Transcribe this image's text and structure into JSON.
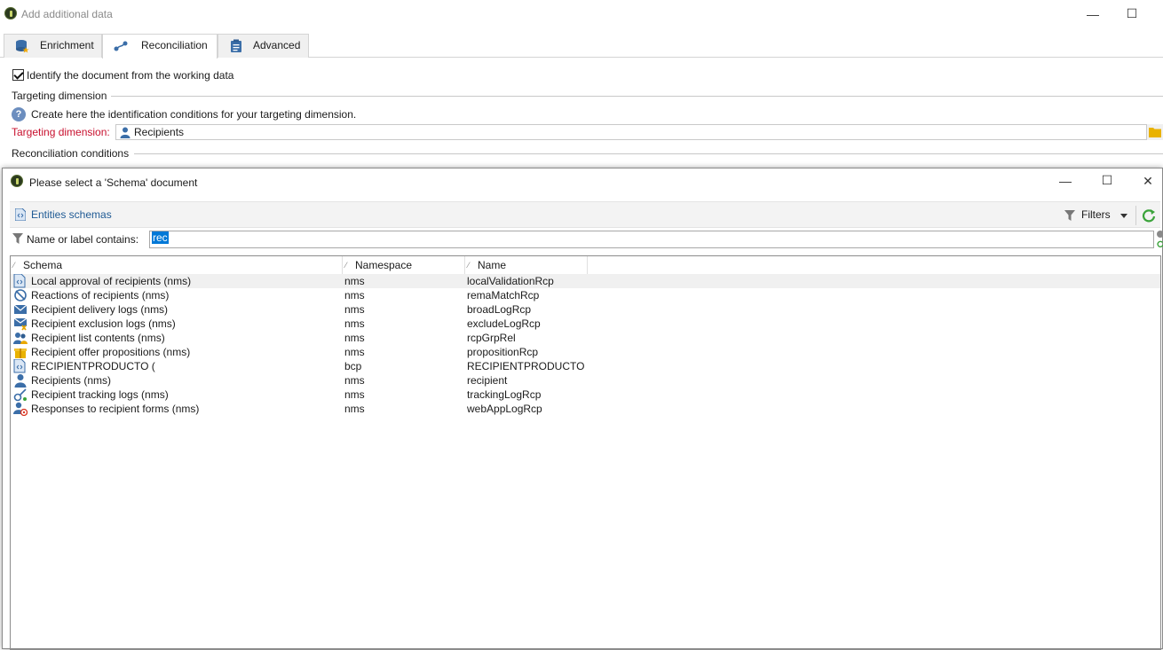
{
  "outer_window": {
    "title": "Add additional data",
    "minimize": "—",
    "maximize": "☐"
  },
  "tabs": [
    {
      "label": "Enrichment",
      "icon": "database-star-icon"
    },
    {
      "label": "Reconciliation",
      "icon": "link-icon"
    },
    {
      "label": "Advanced",
      "icon": "clipboard-icon"
    }
  ],
  "reconciliation": {
    "checkbox_label": "Identify the document from the working data",
    "section_targeting": "Targeting dimension",
    "help_text": "Create here the identification conditions for your targeting dimension.",
    "targeting_label": "Targeting dimension:",
    "targeting_value": "Recipients",
    "section_conditions": "Reconciliation conditions"
  },
  "modal": {
    "title": "Please select a 'Schema' document",
    "minimize": "—",
    "maximize": "☐",
    "close": "✕",
    "folder_link": "Entities schemas",
    "filters_label": "Filters",
    "filter_label": "Name or label contains:",
    "filter_value": "rec",
    "columns": [
      "Schema",
      "Namespace",
      "Name"
    ],
    "rows": [
      {
        "schema": "Local approval of recipients (nms)",
        "namespace": "nms",
        "name": "localValidationRcp",
        "icon": "schema-doc-icon"
      },
      {
        "schema": "Reactions of recipients (nms)",
        "namespace": "nms",
        "name": "remaMatchRcp",
        "icon": "reaction-icon"
      },
      {
        "schema": "Recipient delivery logs (nms)",
        "namespace": "nms",
        "name": "broadLogRcp",
        "icon": "envelope-icon"
      },
      {
        "schema": "Recipient exclusion logs (nms)",
        "namespace": "nms",
        "name": "excludeLogRcp",
        "icon": "envelope-exclusion-icon"
      },
      {
        "schema": "Recipient list contents (nms)",
        "namespace": "nms",
        "name": "rcpGrpRel",
        "icon": "group-icon"
      },
      {
        "schema": "Recipient offer propositions (nms)",
        "namespace": "nms",
        "name": "propositionRcp",
        "icon": "gift-icon"
      },
      {
        "schema": "RECIPIENTPRODUCTO (",
        "namespace": "bcp",
        "name": "RECIPIENTPRODUCTO",
        "icon": "schema-doc-icon"
      },
      {
        "schema": "Recipients (nms)",
        "namespace": "nms",
        "name": "recipient",
        "icon": "person-icon"
      },
      {
        "schema": "Recipient tracking logs (nms)",
        "namespace": "nms",
        "name": "trackingLogRcp",
        "icon": "tracking-icon"
      },
      {
        "schema": "Responses to recipient forms (nms)",
        "namespace": "nms",
        "name": "webAppLogRcp",
        "icon": "person-at-icon"
      }
    ]
  },
  "colors": {
    "accent_blue": "#1f5a94",
    "label_red": "#c8102e",
    "selection": "#0078d7",
    "refresh_green": "#3aa33a"
  }
}
